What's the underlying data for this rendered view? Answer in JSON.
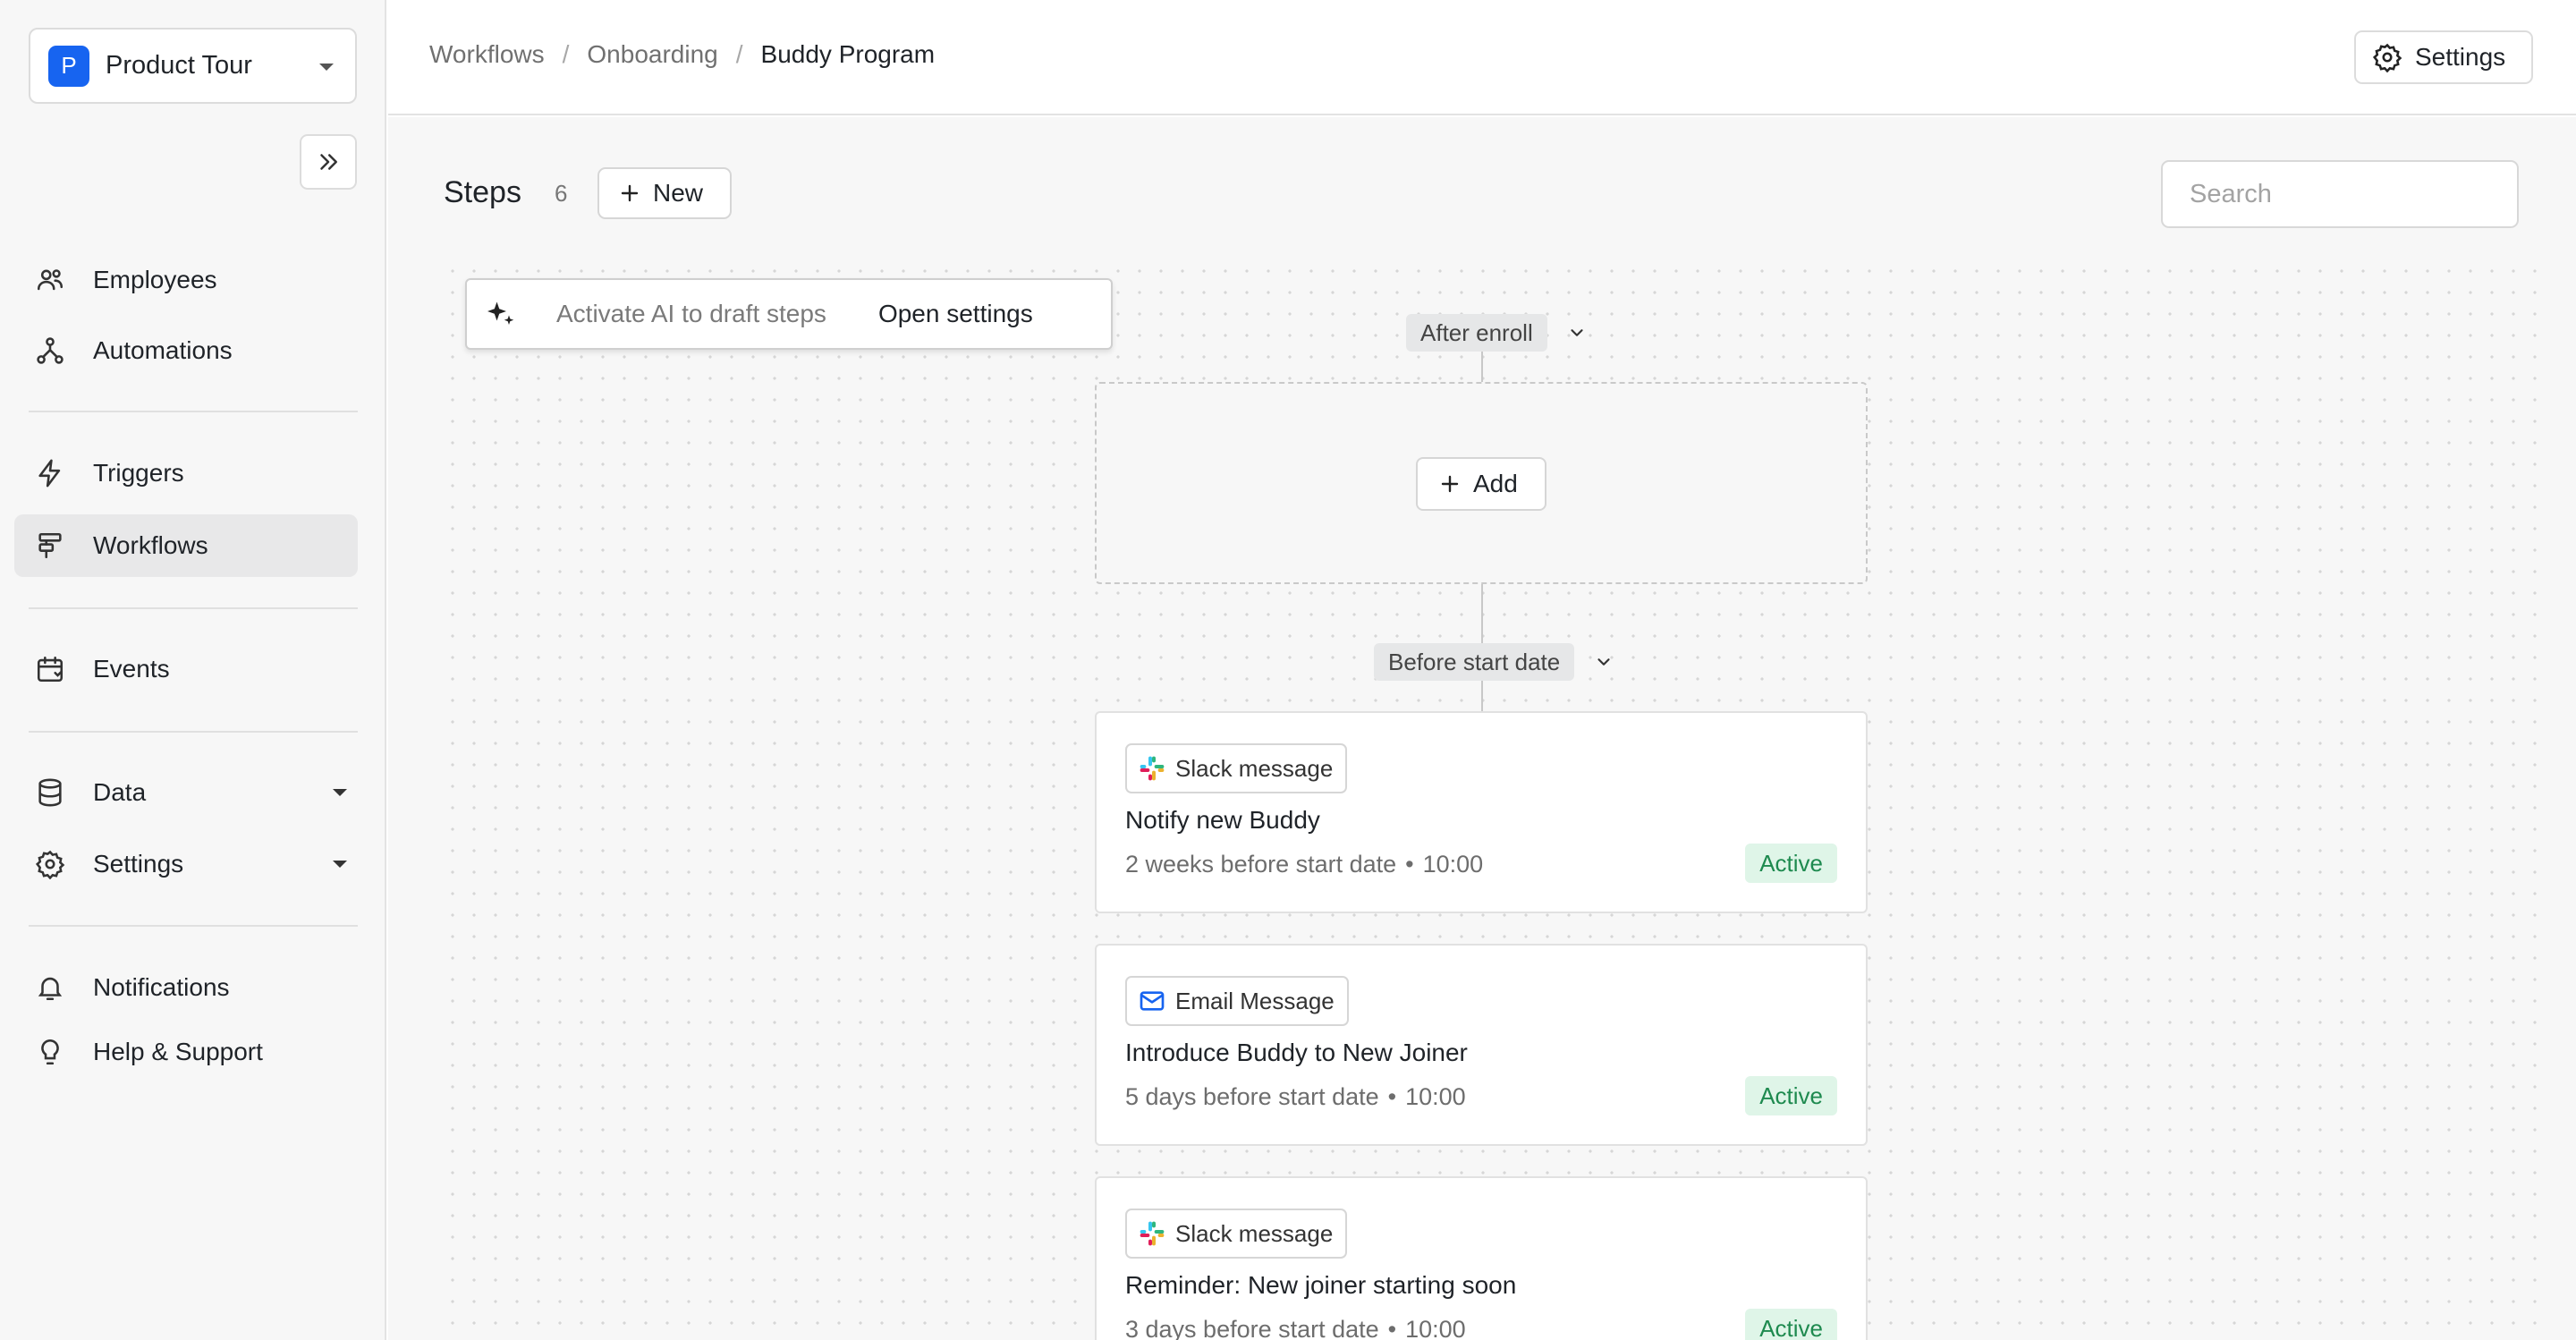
{
  "workspace": {
    "initial": "P",
    "name": "Product Tour",
    "accent": "#1764f0"
  },
  "sidebar": {
    "items": [
      {
        "label": "Employees",
        "icon": "users-icon"
      },
      {
        "label": "Automations",
        "icon": "automation-icon"
      },
      {
        "label": "Triggers",
        "icon": "lightning-icon"
      },
      {
        "label": "Workflows",
        "icon": "workflow-icon",
        "active": true
      },
      {
        "label": "Events",
        "icon": "calendar-icon"
      },
      {
        "label": "Data",
        "icon": "database-icon",
        "expandable": true
      },
      {
        "label": "Settings",
        "icon": "gear-icon",
        "expandable": true
      },
      {
        "label": "Notifications",
        "icon": "bell-icon"
      },
      {
        "label": "Help & Support",
        "icon": "lightbulb-icon"
      }
    ]
  },
  "breadcrumb": [
    "Workflows",
    "Onboarding",
    "Buddy Program"
  ],
  "header": {
    "settings_label": "Settings"
  },
  "steps": {
    "title": "Steps",
    "count": "6",
    "new_label": "New"
  },
  "search": {
    "placeholder": "Search",
    "value": ""
  },
  "ai_banner": {
    "text": "Activate AI to draft steps",
    "link": "Open settings"
  },
  "stages": [
    {
      "label": "After enroll",
      "add_label": "Add"
    },
    {
      "label": "Before start date"
    }
  ],
  "cards": [
    {
      "type": "Slack message",
      "icon": "slack-icon",
      "title": "Notify new Buddy",
      "timing": "2 weeks before start date",
      "time": "10:00",
      "status": "Active"
    },
    {
      "type": "Email Message",
      "icon": "mail-icon",
      "title": "Introduce Buddy to New Joiner",
      "timing": "5 days before start date",
      "time": "10:00",
      "status": "Active"
    },
    {
      "type": "Slack message",
      "icon": "slack-icon",
      "title": "Reminder: New joiner starting soon",
      "timing": "3 days before start date",
      "time": "10:00",
      "status": "Active"
    }
  ],
  "colors": {
    "active_badge_bg": "#dff5e8",
    "active_badge_fg": "#1e8a4f",
    "canvas_bg": "#f7f7f7"
  }
}
